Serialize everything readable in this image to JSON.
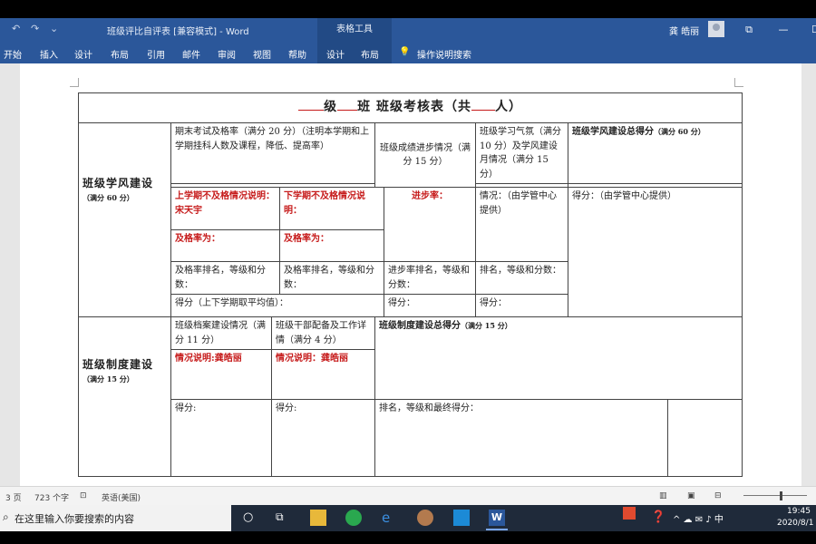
{
  "titlebar": {
    "title": "班级评比自评表 [兼容模式] - Word",
    "context_tab": "表格工具",
    "user": "龚 皓丽",
    "qat": [
      "↶",
      "↷",
      "⌄"
    ],
    "win_buttons": [
      "⧉",
      "—",
      "☐"
    ]
  },
  "ribbon": {
    "tabs": [
      "开始",
      "插入",
      "设计",
      "布局",
      "引用",
      "邮件",
      "审阅",
      "视图",
      "帮助",
      "设计",
      "布局"
    ],
    "tell_me": "操作说明搜索"
  },
  "table": {
    "title": {
      "a": "级",
      "b": "班 班级考核表（共",
      "c": "人）"
    },
    "sec1": {
      "heading": "班级学风建设",
      "sub": "（满分 60 分）",
      "h_exam": "期末考试及格率（满分 20 分）（注明本学期和上学期挂科人数及课程，降低、提高率）",
      "h_progress": "班级成绩进步情况（满分 15 分）",
      "h_atmos": "班级学习气氛（满分 10 分）及学风建设月情况（满分 15 分）",
      "h_total": "班级学风建设总得分",
      "h_total_note": "（满分 60 分）",
      "last_fail": "上学期不及格情况说明：宋天宇",
      "this_fail": "下学期不及格情况说明：",
      "progress_rate": "进步率：",
      "atmos_situation": "情况：（由学管中心提供）",
      "total_score": "得分：（由学管中心提供）",
      "pass_rate_1": "及格率为：",
      "pass_rate_2": "及格率为：",
      "rank_1": "及格率排名，等级和分数：",
      "rank_2": "及格率排名，等级和分数：",
      "rank_progress": "进步率排名，等级和分数：",
      "rank_atmos": "排名，等级和分数：",
      "score_avg": "得分（上下学期取平均值）：",
      "score_progress": "得分：",
      "score_atmos": "得分："
    },
    "sec2": {
      "heading": "班级制度建设",
      "sub": "（满分 15 分）",
      "h_archive": "班级档案建设情况（满分 11 分）",
      "h_cadre": "班级干部配备及工作详情（满分 4 分）",
      "h_total": "班级制度建设总得分",
      "h_total_note": "（满分 15 分）",
      "archive_note": "情况说明:龚皓丽",
      "cadre_note": "情况说明：龚皓丽",
      "score_archive": "得分:",
      "score_cadre": "得分:",
      "final": "排名，等级和最终得分："
    }
  },
  "statusbar": {
    "page": "3 页",
    "words": "723 个字",
    "lang": "英语(美国)"
  },
  "taskbar": {
    "search_placeholder": "在这里输入你要搜索的内容",
    "time": "19:45",
    "date": "2020/8/1",
    "tray": "^ ☁ ✉ ♪ 中"
  },
  "colors": {
    "word_blue": "#2b579a",
    "red_text": "#c61a1a"
  }
}
